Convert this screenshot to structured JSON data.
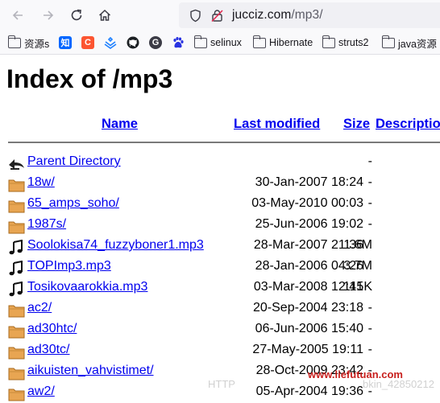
{
  "browser": {
    "url_domain": "jucciz.com",
    "url_path": "/mp3/"
  },
  "bookmarks": [
    {
      "label": "资源s",
      "icon": "folder-icon"
    },
    {
      "label": "知",
      "icon": "zhihu-icon",
      "color": "#0066ff"
    },
    {
      "label": "C",
      "icon": "csdn-icon",
      "color": "#fc5531"
    },
    {
      "label": "",
      "icon": "juejin-icon",
      "color": "#1e80ff"
    },
    {
      "label": "",
      "icon": "github-icon"
    },
    {
      "label": "",
      "icon": "g-icon"
    },
    {
      "label": "",
      "icon": "baidu-icon",
      "color": "#2932e1"
    },
    {
      "label": "selinux",
      "icon": "folder-icon"
    },
    {
      "label": "Hibernate",
      "icon": "folder-icon"
    },
    {
      "label": "struts2",
      "icon": "folder-icon"
    },
    {
      "label": "java资源",
      "icon": "folder-icon"
    }
  ],
  "page": {
    "title": "Index of /mp3",
    "columns": {
      "name": "Name",
      "last_modified": "Last modified",
      "size": "Size",
      "description": "Description"
    },
    "rows": [
      {
        "name": "Parent Directory",
        "date": "",
        "size": "-",
        "icon": "back-arrow-icon"
      },
      {
        "name": "18w/",
        "date": "30-Jan-2007 18:24",
        "size": "-",
        "icon": "folder-icon"
      },
      {
        "name": "65_amps_soho/",
        "date": "03-May-2010 00:03",
        "size": "-",
        "icon": "folder-icon"
      },
      {
        "name": "1987s/",
        "date": "25-Jun-2006 19:02",
        "size": "-",
        "icon": "folder-icon"
      },
      {
        "name": "Soolokisa74_fuzzyboner1.mp3",
        "date": "28-Mar-2007 21:36",
        "size": "1.6M",
        "icon": "music-note-icon"
      },
      {
        "name": "TOPImp3.mp3",
        "date": "28-Jan-2006 04:26",
        "size": "3.7M",
        "icon": "music-note-icon"
      },
      {
        "name": "Tosikovaarokkia.mp3",
        "date": "03-Mar-2008 12:41",
        "size": "115K",
        "icon": "music-note-icon"
      },
      {
        "name": "ac2/",
        "date": "20-Sep-2004 23:18",
        "size": "-",
        "icon": "folder-icon"
      },
      {
        "name": "ad30htc/",
        "date": "06-Jun-2006 15:40",
        "size": "-",
        "icon": "folder-icon"
      },
      {
        "name": "ad30tc/",
        "date": "27-May-2005 19:11",
        "size": "-",
        "icon": "folder-icon"
      },
      {
        "name": "aikuisten_vahvistimet/",
        "date": "28-Oct-2009 23:42",
        "size": "-",
        "icon": "folder-icon"
      },
      {
        "name": "aw2/",
        "date": "05-Apr-2004 19:36",
        "size": "-",
        "icon": "folder-icon"
      }
    ]
  },
  "watermark": {
    "left_text": "HTTP",
    "site_text": "www.liefutuan.com",
    "right_text": "bkin_42850212"
  },
  "colors": {
    "link": "#0000ee",
    "folder": "#e8a552",
    "watermark_site": "#c8201e"
  }
}
